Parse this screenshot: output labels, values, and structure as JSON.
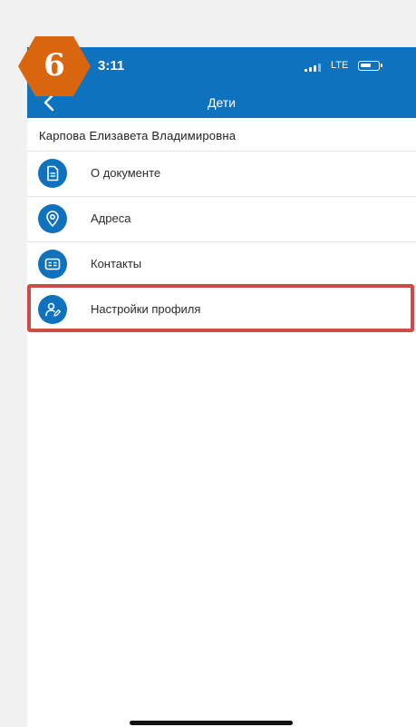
{
  "status_bar": {
    "time": "3:11",
    "network": "LTE",
    "icons": [
      "signal-icon",
      "battery-icon"
    ]
  },
  "nav": {
    "title": "Дети",
    "back_icon": "chevron-left-icon"
  },
  "person": {
    "name": "Карпова Елизавета Владимировна"
  },
  "menu": [
    {
      "label": "О документе",
      "icon": "document-icon"
    },
    {
      "label": "Адреса",
      "icon": "location-pin-icon"
    },
    {
      "label": "Контакты",
      "icon": "contact-card-icon"
    },
    {
      "label": "Настройки профиля",
      "icon": "user-edit-icon"
    }
  ],
  "annotation": {
    "step_number": "6",
    "badge_color": "#d9650f",
    "highlight_color": "#cf4b47",
    "highlighted_item": "Настройки профиля"
  },
  "colors": {
    "brand_blue": "#0e72bf",
    "background": "#f1f1f1"
  }
}
